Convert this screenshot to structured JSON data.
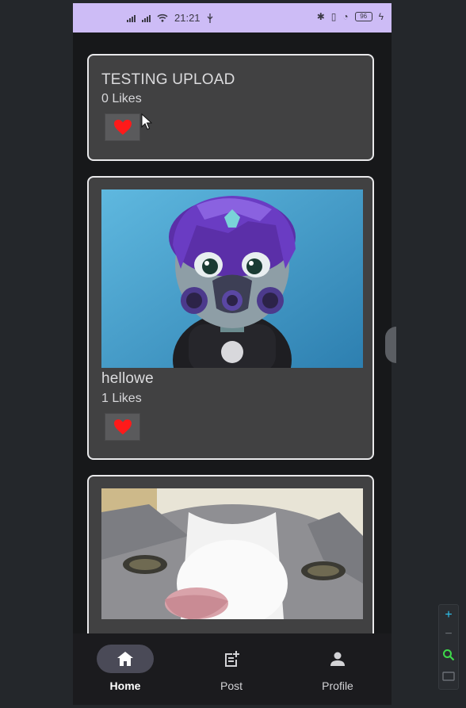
{
  "status_bar": {
    "time": "21:21",
    "battery": "96"
  },
  "posts": [
    {
      "title": "TESTING UPLOAD",
      "likes": "0 Likes",
      "has_image": false
    },
    {
      "title": "hellowe",
      "likes": "1 Likes",
      "has_image": true,
      "image": "3d-avatar-gas-mask-purple-hair"
    },
    {
      "title": "",
      "likes": "",
      "has_image": true,
      "image": "grey-white-cat-closeup"
    }
  ],
  "bottom_nav": {
    "items": [
      {
        "label": "Home",
        "icon": "home-icon",
        "active": true
      },
      {
        "label": "Post",
        "icon": "add-post-icon",
        "active": false
      },
      {
        "label": "Profile",
        "icon": "person-icon",
        "active": false
      }
    ]
  },
  "colors": {
    "status_bar": "#cdbcf6",
    "card_bg": "#414142",
    "card_border": "#e9e9eb",
    "heart": "#ff1a1a",
    "nav_active_pill": "#4a4a57",
    "zoom_accent": "#2ec4f0",
    "zoom_search": "#3ed94a"
  }
}
